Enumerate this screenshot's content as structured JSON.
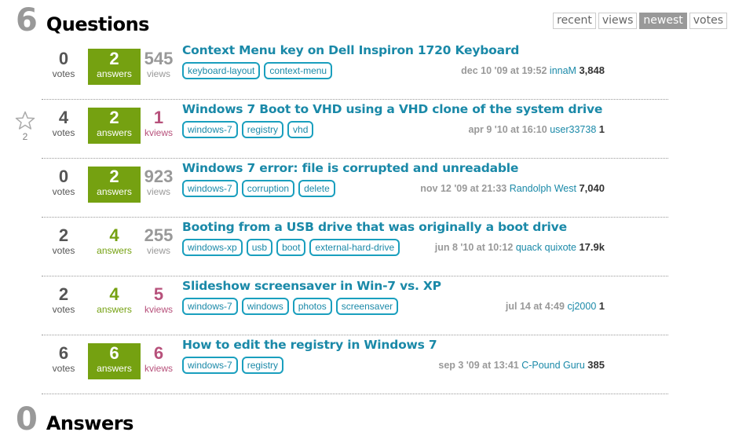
{
  "questions_header": {
    "count": "6",
    "title": "Questions"
  },
  "answers_header": {
    "count": "0",
    "title": "Answers"
  },
  "sort_tabs": [
    {
      "label": "recent",
      "active": false
    },
    {
      "label": "views",
      "active": false
    },
    {
      "label": "newest",
      "active": true
    },
    {
      "label": "votes",
      "active": false
    }
  ],
  "colors": {
    "accepted_answers_bg": "#75a111",
    "link": "#1a89a8",
    "hot_views": "#b7517b",
    "muted": "#999999"
  },
  "questions": [
    {
      "votes": "0",
      "votes_label": "votes",
      "answers": "2",
      "answers_label": "answers",
      "accepted": true,
      "views": "545",
      "views_label": "views",
      "views_hot": false,
      "title": "Context Menu key on Dell Inspiron 1720 Keyboard",
      "tags": [
        "keyboard-layout",
        "context-menu"
      ],
      "when": "dec 10 '09 at 19:52",
      "user": "innaM",
      "rep": "3,848",
      "favorite": null
    },
    {
      "votes": "4",
      "votes_label": "votes",
      "answers": "2",
      "answers_label": "answers",
      "accepted": true,
      "views": "1",
      "views_label": "kviews",
      "views_hot": true,
      "title": "Windows 7 Boot to VHD using a VHD clone of the system drive",
      "tags": [
        "windows-7",
        "registry",
        "vhd"
      ],
      "when": "apr 9 '10 at 16:10",
      "user": "user33738",
      "rep": "1",
      "favorite": {
        "icon": "star-outline-icon",
        "count": "2"
      }
    },
    {
      "votes": "0",
      "votes_label": "votes",
      "answers": "2",
      "answers_label": "answers",
      "accepted": true,
      "views": "923",
      "views_label": "views",
      "views_hot": false,
      "title": "Windows 7 error: file is corrupted and unreadable",
      "tags": [
        "windows-7",
        "corruption",
        "delete"
      ],
      "when": "nov 12 '09 at 21:33",
      "user": "Randolph West",
      "rep": "7,040",
      "favorite": null
    },
    {
      "votes": "2",
      "votes_label": "votes",
      "answers": "4",
      "answers_label": "answers",
      "accepted": false,
      "views": "255",
      "views_label": "views",
      "views_hot": false,
      "title": "Booting from a USB drive that was originally a boot drive",
      "tags": [
        "windows-xp",
        "usb",
        "boot",
        "external-hard-drive"
      ],
      "when": "jun 8 '10 at 10:12",
      "user": "quack quixote",
      "rep": "17.9k",
      "favorite": null
    },
    {
      "votes": "2",
      "votes_label": "votes",
      "answers": "4",
      "answers_label": "answers",
      "accepted": false,
      "views": "5",
      "views_label": "kviews",
      "views_hot": true,
      "title": "Slideshow screensaver in Win-7 vs. XP",
      "tags": [
        "windows-7",
        "windows",
        "photos",
        "screensaver"
      ],
      "when": "jul 14 at 4:49",
      "user": "cj2000",
      "rep": "1",
      "favorite": null
    },
    {
      "votes": "6",
      "votes_label": "votes",
      "answers": "6",
      "answers_label": "answers",
      "accepted": true,
      "views": "6",
      "views_label": "kviews",
      "views_hot": true,
      "title": "How to edit the registry in Windows 7",
      "tags": [
        "windows-7",
        "registry"
      ],
      "when": "sep 3 '09 at 13:41",
      "user": "C-Pound Guru",
      "rep": "385",
      "favorite": null
    }
  ]
}
